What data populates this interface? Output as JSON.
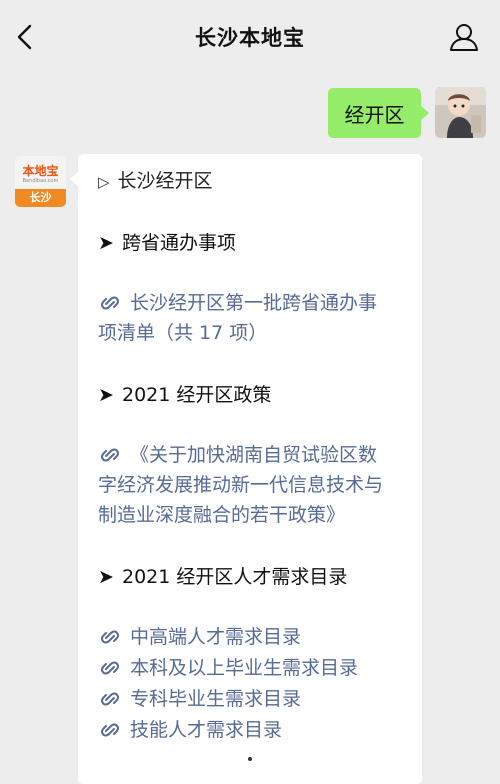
{
  "header": {
    "title": "长沙本地宝",
    "back_icon": "chevron-left-icon",
    "profile_icon": "person-icon"
  },
  "chat": {
    "outgoing_text": "经开区",
    "bot_avatar": {
      "logo_text": "本地宝",
      "site_text": "Bendibao.com",
      "city_text": "长沙"
    },
    "reply": {
      "heading_symbol": "▷",
      "heading": "长沙经开区",
      "sections": [
        {
          "symbol": "➤",
          "title": "跨省通办事项",
          "links": [
            {
              "line1": "长沙经开区第一批跨省通办事",
              "line2": "项清单（共 17 项）"
            }
          ]
        },
        {
          "symbol": "➤",
          "title": "2021 经开区政策",
          "links": [
            {
              "line1": "《关于加快湖南自贸试验区数",
              "line2": "字经济发展推动新一代信息技术与",
              "line3": "制造业深度融合的若干政策》"
            }
          ]
        },
        {
          "symbol": "➤",
          "title": "2021 经开区人才需求目录",
          "links": [
            {
              "line1": "中高端人才需求目录"
            },
            {
              "line1": "本科及以上毕业生需求目录"
            },
            {
              "line1": "专科毕业生需求目录"
            },
            {
              "line1": "技能人才需求目录"
            }
          ]
        }
      ]
    }
  },
  "colors": {
    "background": "#ededed",
    "outgoing_bubble": "#95ec69",
    "link": "#576b95",
    "brand_orange": "#f08a22"
  }
}
